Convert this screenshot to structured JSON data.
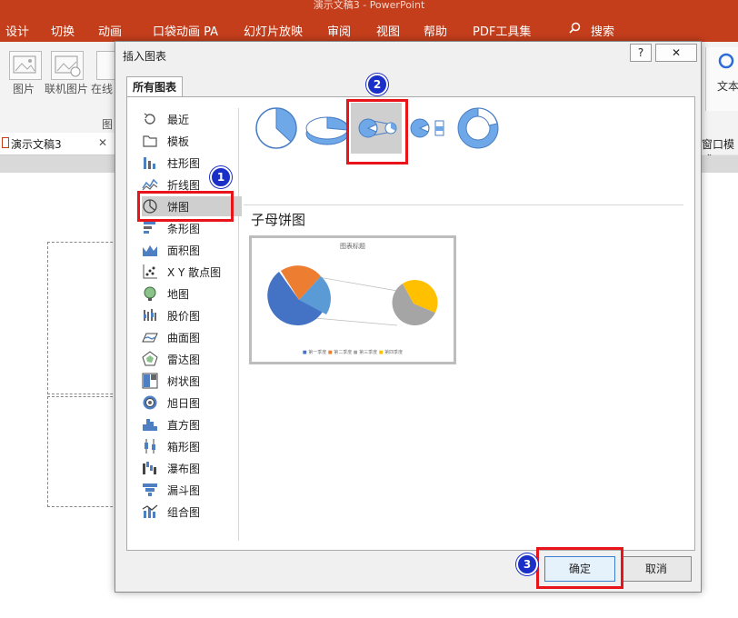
{
  "app": {
    "window_title": "演示文稿3 - PowerPoint",
    "ribbon_tabs": [
      "设计",
      "切换",
      "动画",
      "口袋动画 PA",
      "幻灯片放映",
      "审阅",
      "视图",
      "帮助",
      "PDF工具集"
    ],
    "search_label": "搜索",
    "ribbon_buttons": [
      "图片",
      "联机图片",
      "在线"
    ],
    "ribbon_group_label": "图",
    "ribbon_right_label": "文本",
    "doc_tab": "演示文稿3",
    "right_strip_label": "窗口模式"
  },
  "dialog": {
    "title": "插入图表",
    "help_label": "?",
    "close_label": "✕",
    "tab": "所有图表",
    "chart_types": [
      "最近",
      "模板",
      "柱形图",
      "折线图",
      "饼图",
      "条形图",
      "面积图",
      "X Y 散点图",
      "地图",
      "股价图",
      "曲面图",
      "雷达图",
      "树状图",
      "旭日图",
      "直方图",
      "箱形图",
      "瀑布图",
      "漏斗图",
      "组合图"
    ],
    "selected_type": "饼图",
    "subtype_title": "子母饼图",
    "preview_title": "图表标题",
    "preview_legend": [
      "第一季度",
      "第二季度",
      "第三季度",
      "第四季度"
    ],
    "ok_label": "确定",
    "cancel_label": "取消",
    "step_markers": [
      "1",
      "2",
      "3"
    ]
  },
  "colors": {
    "accent": "#c43e1c",
    "highlight": "#e8141a",
    "marker": "#1a2fc8",
    "pie_blue": "#4472c4",
    "pie_orange": "#ed7d31",
    "pie_gray": "#a5a5a5",
    "pie_gold": "#ffc000",
    "pie_lightblue": "#5b9bd5"
  },
  "icons": [
    "search-icon",
    "picture-icon",
    "online-picture-icon",
    "recent-icon",
    "template-icon",
    "column-chart-icon",
    "line-chart-icon",
    "pie-chart-icon",
    "bar-chart-icon",
    "area-chart-icon",
    "scatter-chart-icon",
    "map-chart-icon",
    "stock-chart-icon",
    "surface-chart-icon",
    "radar-chart-icon",
    "treemap-icon",
    "sunburst-icon",
    "histogram-icon",
    "box-whisker-icon",
    "waterfall-icon",
    "funnel-icon",
    "combo-chart-icon"
  ]
}
